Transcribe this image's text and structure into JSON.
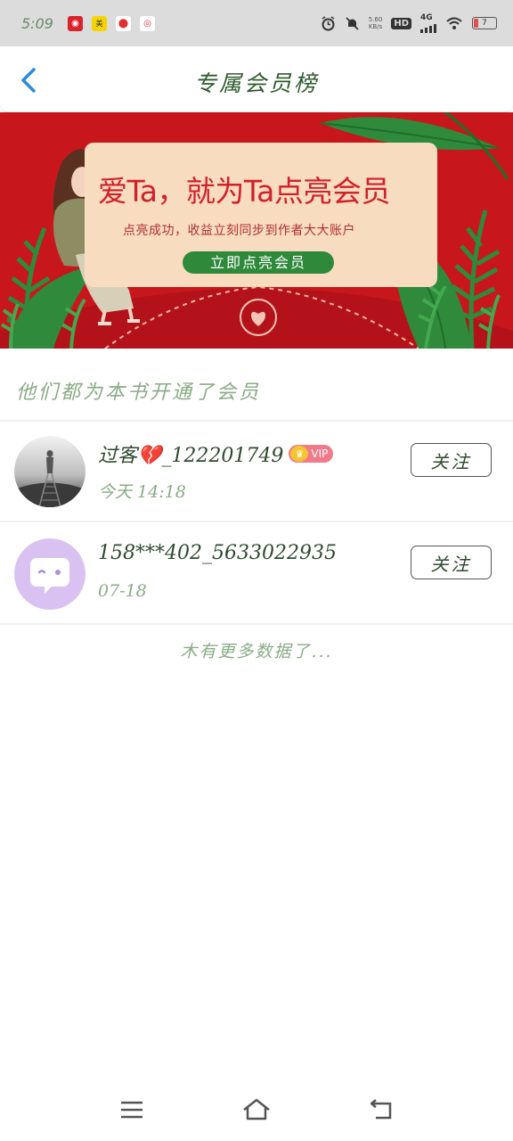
{
  "status_bar": {
    "time": "5:09",
    "net_speed": "5.60",
    "net_speed_unit": "KB/s",
    "hd": "HD",
    "network": "4G",
    "battery": "7",
    "app_icons": [
      "netease-music-icon",
      "meituan-icon",
      "map-pin-icon",
      "weibo-icon"
    ]
  },
  "header": {
    "title": "专属会员榜",
    "back_icon": "chevron-left-icon"
  },
  "banner": {
    "headline": "爱Ta，就为Ta点亮会员",
    "subline": "点亮成功，收益立刻同步到作者大大账户",
    "cta": "立即点亮会员",
    "colors": {
      "background": "#c8171c",
      "card": "#f8dcc0",
      "cta": "#2e8a3a",
      "leaf": "#2f8a3b"
    }
  },
  "section_title": "他们都为本书开通了会员",
  "members": [
    {
      "name": "过客💔_122201749",
      "date": "今天 14:18",
      "vip": true,
      "vip_label": "VIP",
      "follow_label": "关注",
      "avatar_icon": "railway-photo-avatar"
    },
    {
      "name": "158***402_5633022935",
      "date": "07-18",
      "vip": false,
      "follow_label": "关注",
      "avatar_icon": "chat-bubble-avatar"
    }
  ],
  "no_more_text": "木有更多数据了...",
  "nav_bar": {
    "icons": [
      "menu-icon",
      "home-icon",
      "back-icon"
    ]
  },
  "colors": {
    "accent": "#2e5a2e",
    "muted": "#8aab86",
    "back_arrow": "#2a8ad8",
    "vip_badge": "#f07a8a"
  }
}
